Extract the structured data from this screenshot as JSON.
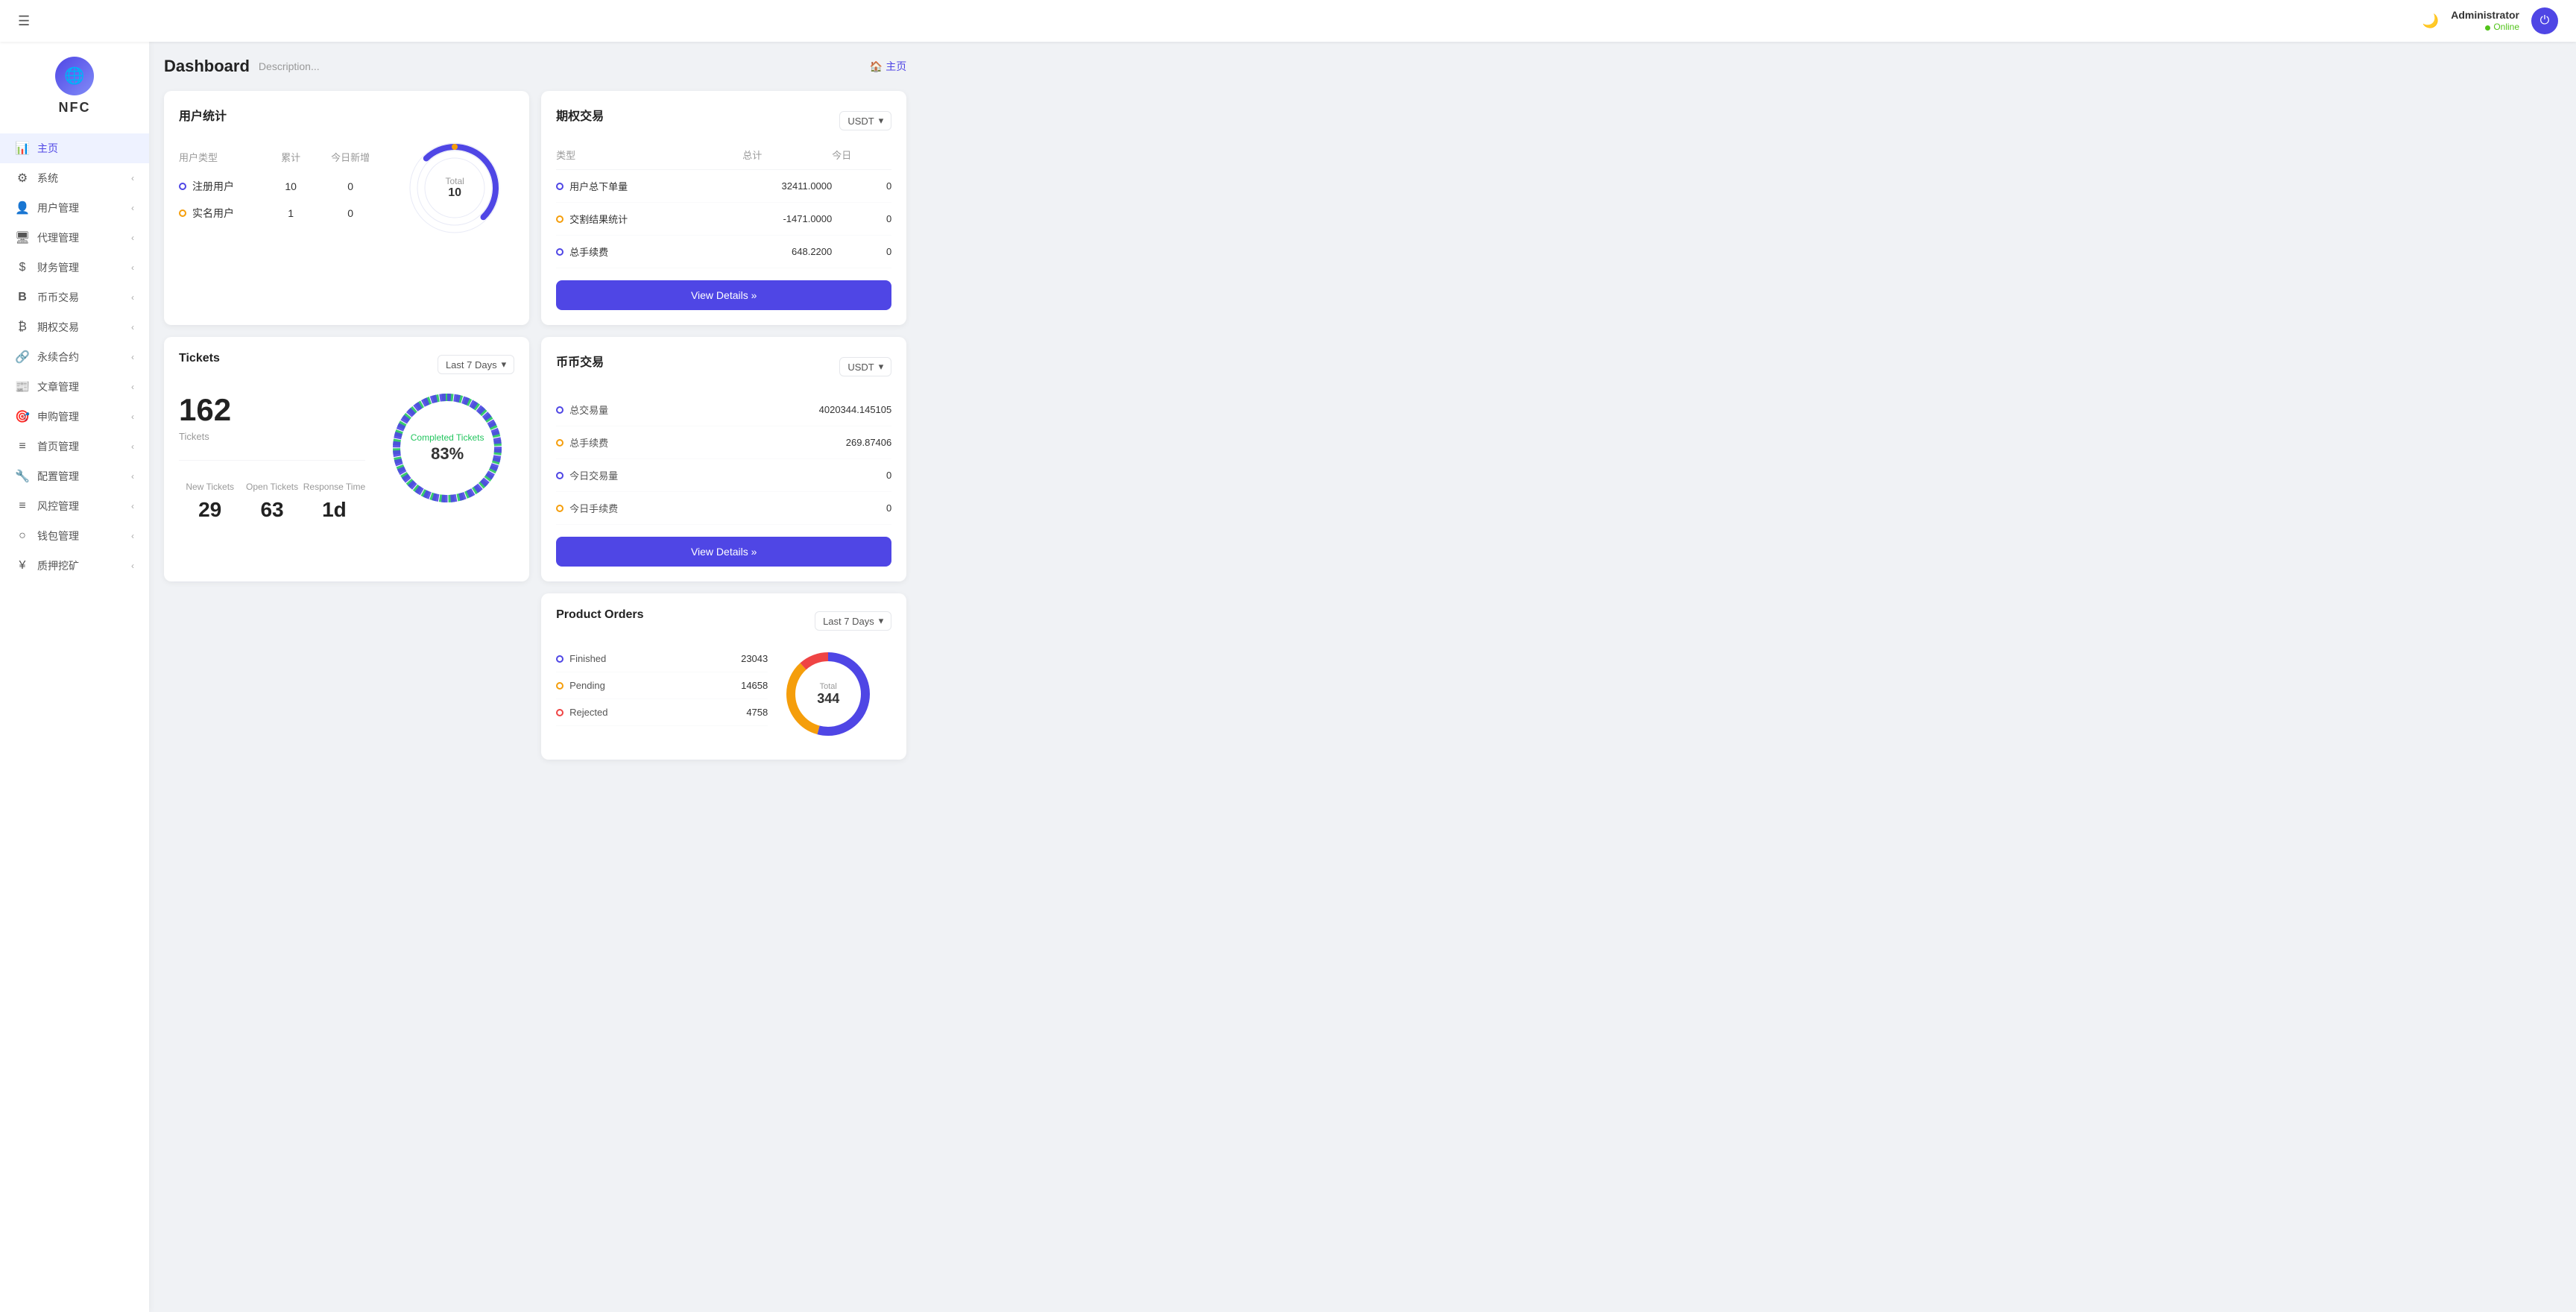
{
  "topbar": {
    "hamburger_icon": "☰",
    "moon_icon": "🌙",
    "admin_name": "Administrator",
    "admin_status": "Online",
    "power_icon": "⏻"
  },
  "sidebar": {
    "logo_text": "NFC",
    "items": [
      {
        "id": "home",
        "label": "主页",
        "icon": "📊",
        "active": true,
        "has_arrow": false
      },
      {
        "id": "system",
        "label": "系统",
        "icon": "⚙️",
        "active": false,
        "has_arrow": true
      },
      {
        "id": "user-mgmt",
        "label": "用户管理",
        "icon": "👤",
        "active": false,
        "has_arrow": true
      },
      {
        "id": "agent-mgmt",
        "label": "代理管理",
        "icon": "🖥️",
        "active": false,
        "has_arrow": true
      },
      {
        "id": "finance",
        "label": "财务管理",
        "icon": "💲",
        "active": false,
        "has_arrow": true
      },
      {
        "id": "coin-trade",
        "label": "币币交易",
        "icon": "B",
        "active": false,
        "has_arrow": true
      },
      {
        "id": "options-trade",
        "label": "期权交易",
        "icon": "₿",
        "active": false,
        "has_arrow": true
      },
      {
        "id": "perpetual",
        "label": "永续合约",
        "icon": "🔗",
        "active": false,
        "has_arrow": true
      },
      {
        "id": "article",
        "label": "文章管理",
        "icon": "📰",
        "active": false,
        "has_arrow": true
      },
      {
        "id": "subscription",
        "label": "申购管理",
        "icon": "🎯",
        "active": false,
        "has_arrow": true
      },
      {
        "id": "homepage-mgmt",
        "label": "首页管理",
        "icon": "≡",
        "active": false,
        "has_arrow": true
      },
      {
        "id": "config",
        "label": "配置管理",
        "icon": "🔧",
        "active": false,
        "has_arrow": true
      },
      {
        "id": "risk",
        "label": "风控管理",
        "icon": "≡",
        "active": false,
        "has_arrow": true
      },
      {
        "id": "wallet",
        "label": "钱包管理",
        "icon": "○",
        "active": false,
        "has_arrow": true
      },
      {
        "id": "mining",
        "label": "质押挖矿",
        "icon": "¥",
        "active": false,
        "has_arrow": true
      }
    ]
  },
  "page": {
    "title": "Dashboard",
    "description": "Description...",
    "home_link": "主页",
    "home_icon": "🏠"
  },
  "user_stats": {
    "title": "用户统计",
    "headers": [
      "用户类型",
      "累计",
      "今日新增"
    ],
    "rows": [
      {
        "type": "注册用户",
        "dot_color": "blue",
        "total": "10",
        "today": "0"
      },
      {
        "type": "实名用户",
        "dot_color": "orange",
        "total": "1",
        "today": "0"
      }
    ],
    "donut": {
      "total_label": "Total",
      "total_value": "10"
    }
  },
  "tickets": {
    "title": "Tickets",
    "period": "Last 7 Days",
    "count": "162",
    "count_label": "Tickets",
    "completed_label": "Completed Tickets",
    "completed_pct": "83%",
    "stats": [
      {
        "label": "New Tickets",
        "value": "29"
      },
      {
        "label": "Open Tickets",
        "value": "63"
      },
      {
        "label": "Response Time",
        "value": "1d"
      }
    ]
  },
  "options_trading": {
    "title": "期权交易",
    "currency": "USDT",
    "headers": [
      "类型",
      "总计",
      "今日"
    ],
    "rows": [
      {
        "type": "用户总下单量",
        "dot": "blue",
        "total": "32411.0000",
        "today": "0"
      },
      {
        "type": "交割结果统计",
        "dot": "orange",
        "total": "-1471.0000",
        "today": "0"
      },
      {
        "type": "总手续费",
        "dot": "blue2",
        "total": "648.2200",
        "today": "0"
      }
    ],
    "view_details_btn": "View Details »"
  },
  "coin_trading": {
    "title": "币币交易",
    "currency": "USDT",
    "rows": [
      {
        "label": "总交易量",
        "value": "4020344.145105",
        "dot": "blue"
      },
      {
        "label": "总手续费",
        "value": "269.87406",
        "dot": "orange"
      },
      {
        "label": "今日交易量",
        "value": "0",
        "dot": "blue"
      },
      {
        "label": "今日手续费",
        "value": "0",
        "dot": "orange"
      }
    ],
    "view_details_btn": "View Details »"
  },
  "product_orders": {
    "title": "Product Orders",
    "period": "Last 7 Days",
    "rows": [
      {
        "label": "Finished",
        "value": "23043",
        "dot": "blue"
      },
      {
        "label": "Pending",
        "value": "14658",
        "dot": "orange"
      },
      {
        "label": "Rejected",
        "value": "4758",
        "dot": "red"
      }
    ],
    "donut": {
      "total_label": "Total",
      "total_value": "344"
    }
  }
}
